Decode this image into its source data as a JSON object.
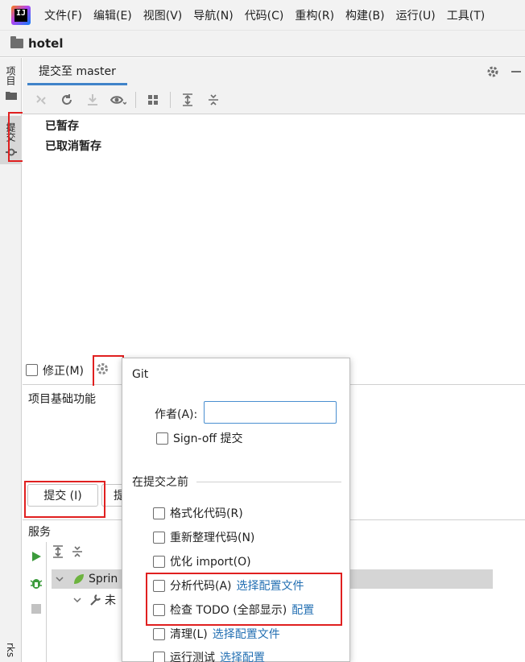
{
  "menubar": {
    "logo_text": "IJ",
    "items": [
      "文件(F)",
      "编辑(E)",
      "视图(V)",
      "导航(N)",
      "代码(C)",
      "重构(R)",
      "构建(B)",
      "运行(U)",
      "工具(T)"
    ]
  },
  "breadcrumb": {
    "project": "hotel"
  },
  "left_stripe": {
    "project_tab": "项目",
    "commit_tab": "提交",
    "bookmarks_tab": "rks"
  },
  "toolwindow": {
    "tab_label": "提交至 master",
    "settings_icon": "gear-icon",
    "minimize_icon": "minus-icon"
  },
  "toolbar": {
    "icons": [
      "merge-icon",
      "refresh-icon",
      "download-icon",
      "eye-icon",
      "group-icon",
      "expand-all-icon",
      "collapse-all-icon"
    ]
  },
  "changes": {
    "stashed": "已暂存",
    "unstashed": "已取消暂存"
  },
  "amend": {
    "label": "修正(M)",
    "checked": false
  },
  "commit_message": {
    "text": "项目基础功能"
  },
  "commit_buttons": {
    "commit": "提交 (I)",
    "commit_push": "提"
  },
  "services": {
    "title": "服务",
    "tree": [
      {
        "label": "Sprin"
      },
      {
        "label": "未"
      }
    ]
  },
  "popup": {
    "git_section": "Git",
    "author_label": "作者(A):",
    "author_value": "",
    "signoff_label": "Sign-off 提交",
    "before_commit_section": "在提交之前",
    "options": [
      {
        "label": "格式化代码(R)",
        "link": "",
        "checked": false
      },
      {
        "label": "重新整理代码(N)",
        "link": "",
        "checked": false
      },
      {
        "label": "优化 import(O)",
        "link": "",
        "checked": false
      },
      {
        "label": "分析代码(A)",
        "link": "选择配置文件",
        "checked": false
      },
      {
        "label": "检查 TODO (全部显示)",
        "link": "配置",
        "checked": false
      },
      {
        "label": "清理(L)",
        "link": "选择配置文件",
        "checked": false
      },
      {
        "label": "运行测试",
        "link": "选择配置",
        "checked": false
      }
    ]
  },
  "colors": {
    "accent": "#4083c9",
    "link": "#2470b3",
    "highlight": "#e02020",
    "run_green": "#3c9b3c"
  }
}
